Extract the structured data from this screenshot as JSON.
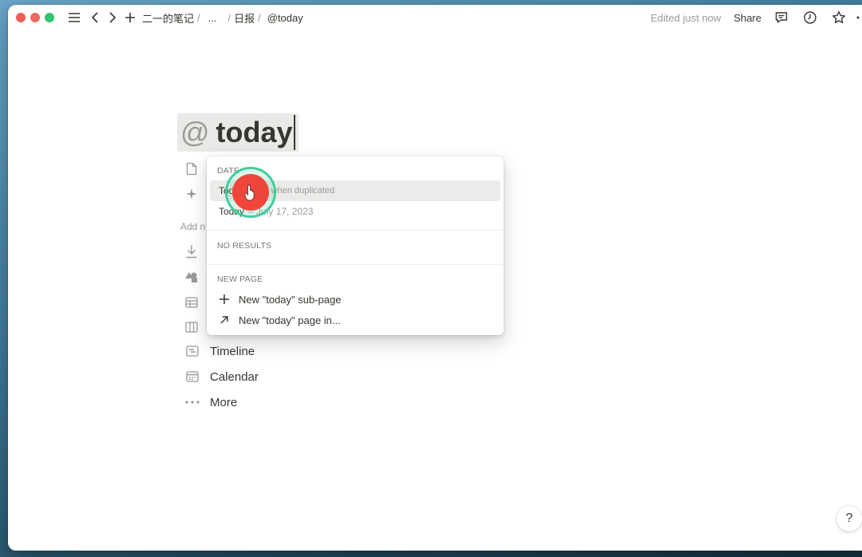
{
  "topbar": {
    "breadcrumbs": [
      "二一的笔记",
      "...",
      "日报",
      "@today"
    ],
    "separator": "/",
    "edited_text": "Edited just now",
    "share_label": "Share"
  },
  "page": {
    "title_prefix": "@",
    "title": "today"
  },
  "add_new_label": "Add n",
  "blocks": [
    {
      "label": "Timeline",
      "icon": "timeline-icon"
    },
    {
      "label": "Calendar",
      "icon": "calendar-icon"
    },
    {
      "label": "More",
      "icon": "more-icon"
    }
  ],
  "mention_menu": {
    "date_section": "DATE",
    "date_items": [
      {
        "label": "Tod",
        "sub": "ate when duplicated"
      },
      {
        "label": "Today",
        "sub": "– July 17, 2023"
      }
    ],
    "no_results": "NO RESULTS",
    "new_page_section": "NEW PAGE",
    "new_page_items": [
      {
        "label": "New \"today\" sub-page",
        "icon": "plus-icon"
      },
      {
        "label": "New \"today\" page in...",
        "icon": "arrow-up-right-icon"
      }
    ]
  },
  "help_label": "?",
  "colors": {
    "text": "#37352f",
    "muted": "#9b9a97",
    "highlight": "#ebebea",
    "cursor_ring": "#3fcf9a",
    "cursor_dot": "#f0463a"
  }
}
